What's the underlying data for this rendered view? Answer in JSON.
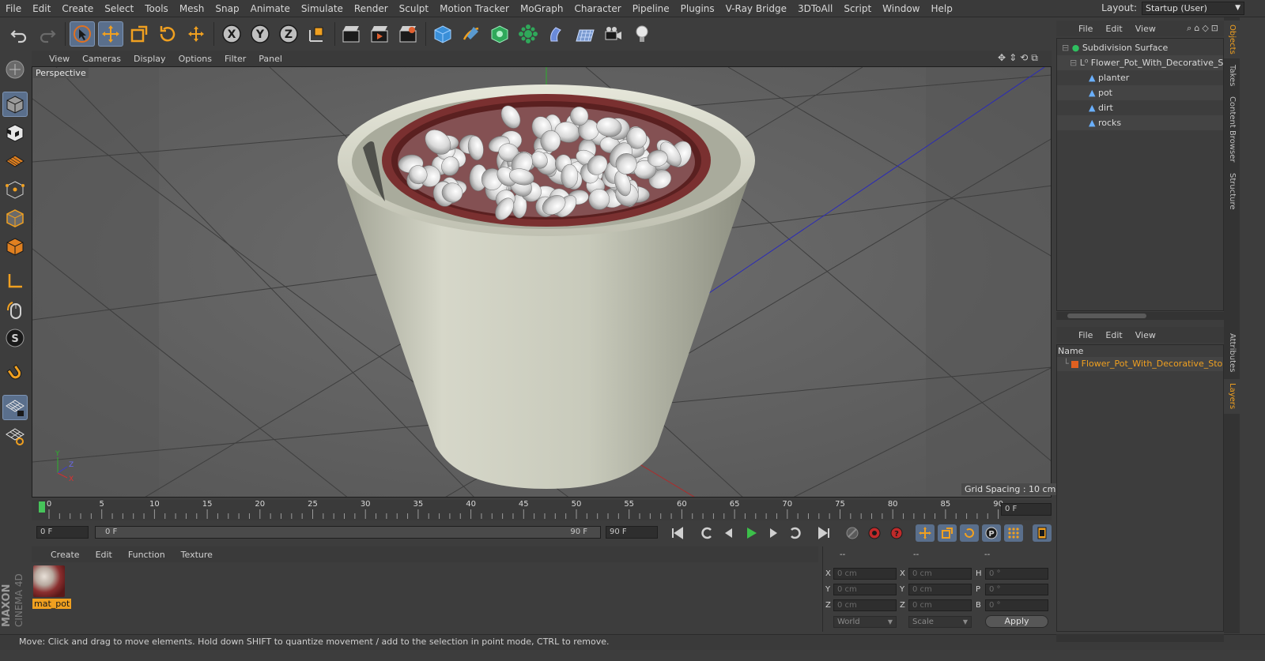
{
  "menu": [
    "File",
    "Edit",
    "Create",
    "Select",
    "Tools",
    "Mesh",
    "Snap",
    "Animate",
    "Simulate",
    "Render",
    "Sculpt",
    "Motion Tracker",
    "MoGraph",
    "Character",
    "Pipeline",
    "Plugins",
    "V-Ray Bridge",
    "3DToAll",
    "Script",
    "Window",
    "Help"
  ],
  "layout": {
    "label": "Layout:",
    "value": "Startup (User)"
  },
  "toolbar": {
    "x_label": "X",
    "y_label": "Y",
    "z_label": "Z"
  },
  "viewport": {
    "menu": [
      "View",
      "Cameras",
      "Display",
      "Options",
      "Filter",
      "Panel"
    ],
    "camera_label": "Perspective",
    "grid_spacing": "Grid Spacing : 10 cm",
    "axis_x": "X",
    "axis_y": "Y",
    "axis_z": "Z"
  },
  "timeline": {
    "ticks": [
      "0",
      "5",
      "10",
      "15",
      "20",
      "25",
      "30",
      "35",
      "40",
      "45",
      "50",
      "55",
      "60",
      "65",
      "70",
      "75",
      "80",
      "85",
      "90"
    ],
    "current_frame": "0 F",
    "start_field": "0 F",
    "range_start": "0 F",
    "range_end": "90 F",
    "end_field": "90 F"
  },
  "material_panel": {
    "menu": [
      "Create",
      "Edit",
      "Function",
      "Texture"
    ],
    "material_name": "mat_pot"
  },
  "coords": {
    "headers": [
      "--",
      "--",
      "--"
    ],
    "rows": [
      {
        "l1": "X",
        "v1": "0 cm",
        "l2": "X",
        "v2": "0 cm",
        "l3": "H",
        "v3": "0 °"
      },
      {
        "l1": "Y",
        "v1": "0 cm",
        "l2": "Y",
        "v2": "0 cm",
        "l3": "P",
        "v3": "0 °"
      },
      {
        "l1": "Z",
        "v1": "0 cm",
        "l2": "Z",
        "v2": "0 cm",
        "l3": "B",
        "v3": "0 °"
      }
    ],
    "space": "World",
    "mode": "Scale",
    "apply": "Apply"
  },
  "brand": {
    "maxon": "MAXON",
    "product": "CINEMA 4D"
  },
  "status": "Move: Click and drag to move elements. Hold down SHIFT to quantize movement / add to the selection in point mode, CTRL to remove.",
  "object_manager": {
    "menu": [
      "File",
      "Edit",
      "View"
    ],
    "objects": [
      "Subdivision Surface",
      "Flower_Pot_With_Decorative_Stones",
      "planter",
      "pot",
      "dirt",
      "rocks"
    ]
  },
  "layers": {
    "menu": [
      "File",
      "Edit",
      "View"
    ],
    "header": "Name",
    "layer": "Flower_Pot_With_Decorative_Stones"
  },
  "side_tabs": [
    "Objects",
    "Takes",
    "Content Browser",
    "Structure",
    "Attributes",
    "Layers"
  ],
  "colors": {
    "accent": "#f0a020",
    "selected_tool": "#5a6f8c",
    "playhead": "#46c45a"
  }
}
